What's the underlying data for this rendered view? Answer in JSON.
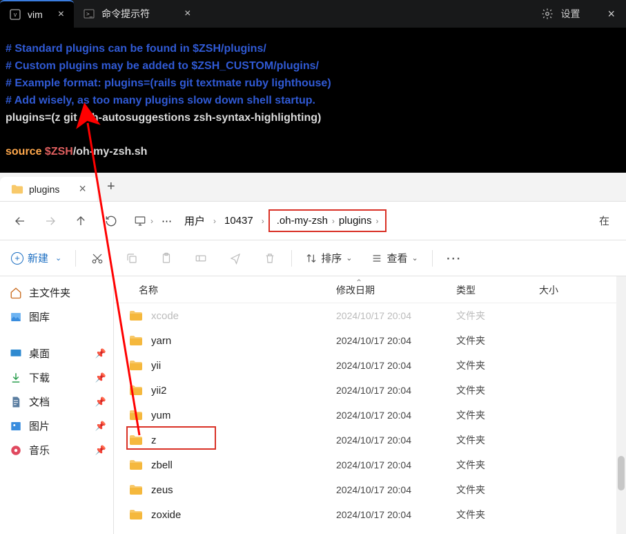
{
  "terminal": {
    "tabs": [
      {
        "icon": "vim",
        "label": "vim",
        "active": true
      },
      {
        "icon": "cmd",
        "label": "命令提示符",
        "active": false
      }
    ],
    "settings_label": "设置",
    "code": {
      "l1": "# Standard plugins can be found in $ZSH/plugins/",
      "l2": "# Custom plugins may be added to $ZSH_CUSTOM/plugins/",
      "l3": "# Example format: plugins=(rails git textmate ruby lighthouse)",
      "l4": "# Add wisely, as too many plugins slow down shell startup.",
      "l5": "plugins=(z git zsh-autosuggestions zsh-syntax-highlighting)",
      "l6_source": "source ",
      "l6_var": "$ZSH",
      "l6_path": "/oh-my-zsh.sh"
    }
  },
  "explorer": {
    "tab_label": "plugins",
    "breadcrumb": {
      "user": "用户",
      "id": "10437",
      "ohmyzsh": ".oh-my-zsh",
      "plugins": "plugins"
    },
    "search_hint": "在",
    "toolbar": {
      "new_label": "新建",
      "sort_label": "排序",
      "view_label": "查看"
    },
    "columns": {
      "name": "名称",
      "date": "修改日期",
      "type": "类型",
      "size": "大小"
    },
    "sidebar": {
      "home": "主文件夹",
      "gallery": "图库",
      "desktop": "桌面",
      "downloads": "下载",
      "documents": "文档",
      "pictures": "图片",
      "music": "音乐"
    },
    "rows": [
      {
        "name": "xcode",
        "date": "2024/10/17 20:04",
        "type": "文件夹",
        "faded": true
      },
      {
        "name": "yarn",
        "date": "2024/10/17 20:04",
        "type": "文件夹"
      },
      {
        "name": "yii",
        "date": "2024/10/17 20:04",
        "type": "文件夹"
      },
      {
        "name": "yii2",
        "date": "2024/10/17 20:04",
        "type": "文件夹"
      },
      {
        "name": "yum",
        "date": "2024/10/17 20:04",
        "type": "文件夹"
      },
      {
        "name": "z",
        "date": "2024/10/17 20:04",
        "type": "文件夹",
        "highlight": true
      },
      {
        "name": "zbell",
        "date": "2024/10/17 20:04",
        "type": "文件夹"
      },
      {
        "name": "zeus",
        "date": "2024/10/17 20:04",
        "type": "文件夹"
      },
      {
        "name": "zoxide",
        "date": "2024/10/17 20:04",
        "type": "文件夹"
      }
    ]
  }
}
